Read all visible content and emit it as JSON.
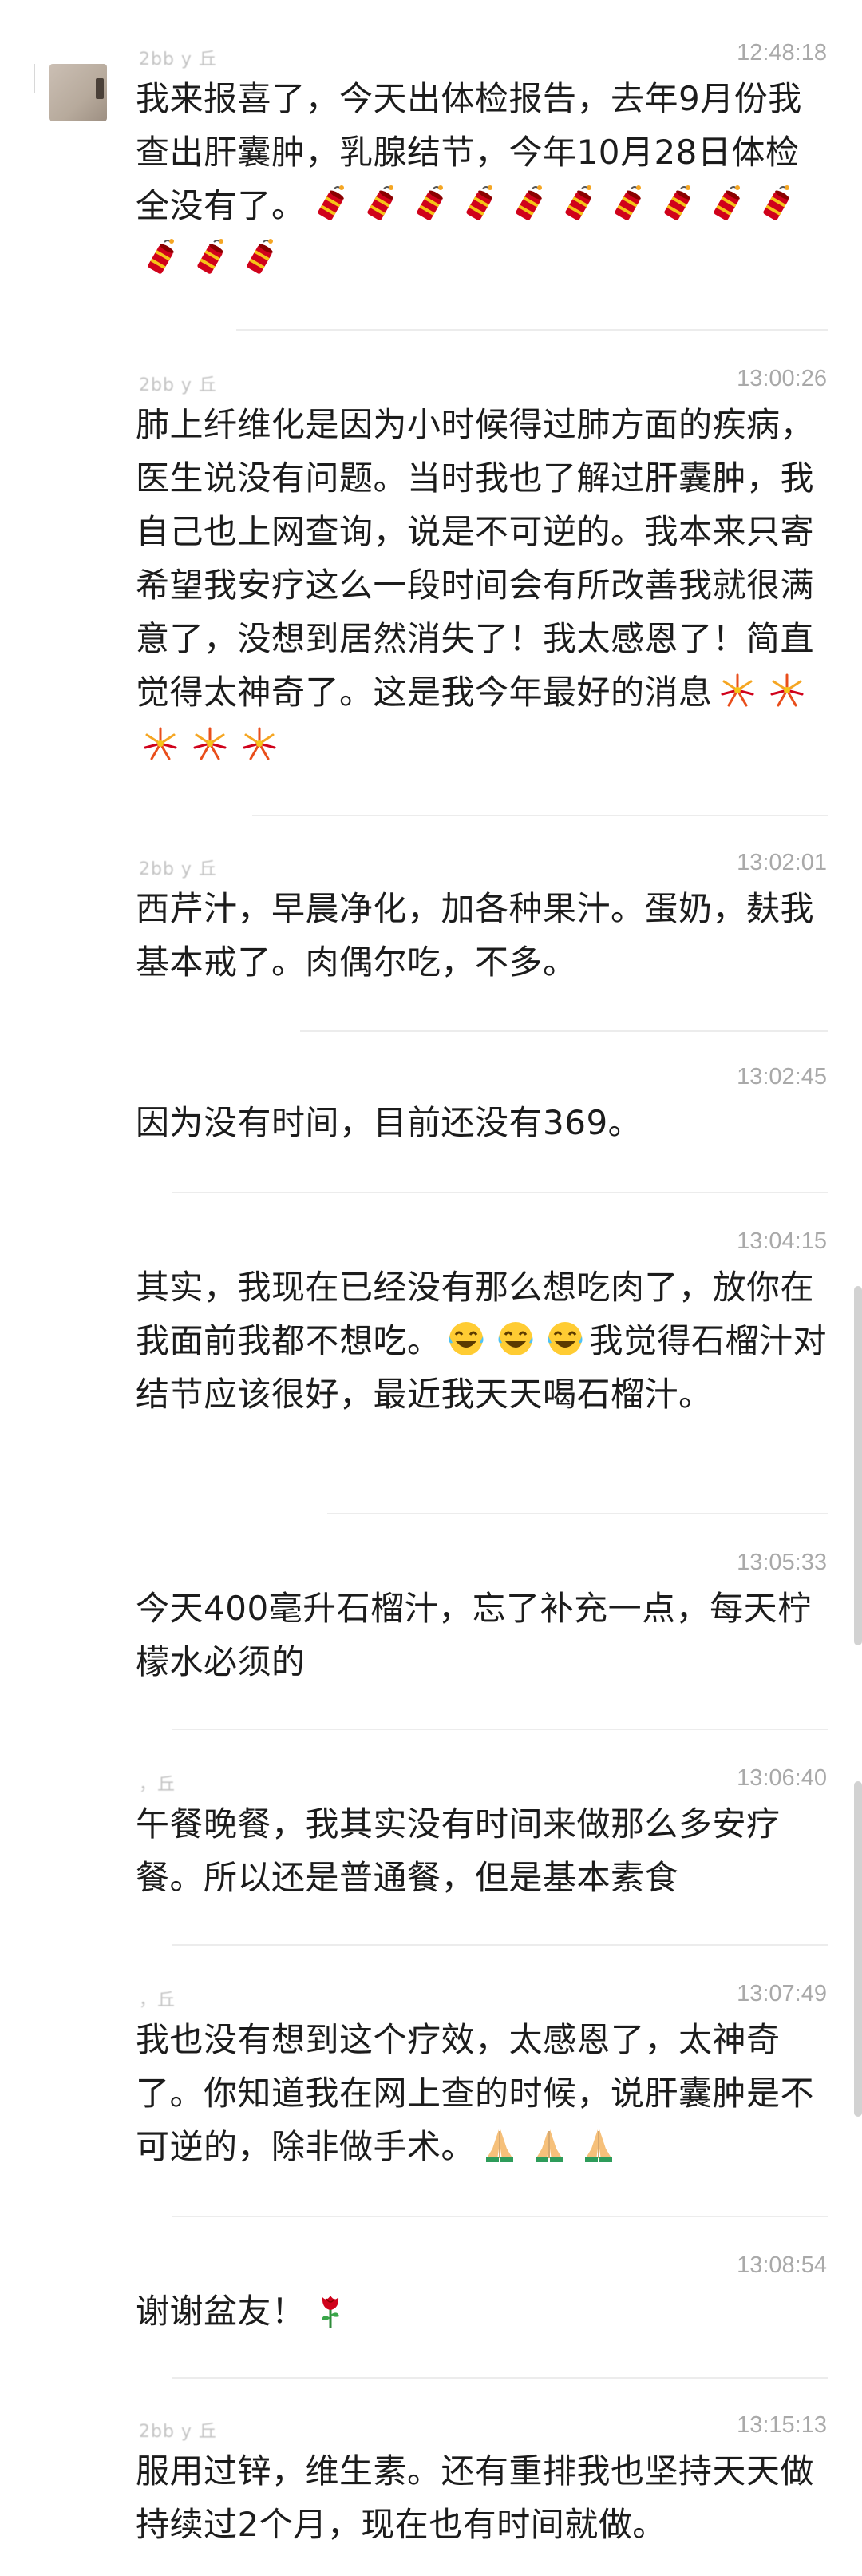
{
  "messages": [
    {
      "sender": "2bb y 丘",
      "time": "12:48:18",
      "segments": [
        {
          "t": "text",
          "v": "我来报喜了，今天出体检报告，去年9月份我查出肝囊肿，乳腺结节，今年10月28日体检全没有了。"
        },
        {
          "t": "icons",
          "icon": "firecracker-icon",
          "count": 13
        }
      ]
    },
    {
      "sender": "2bb y 丘",
      "time": "13:00:26",
      "segments": [
        {
          "t": "text",
          "v": "肺上纤维化是因为小时候得过肺方面的疾病，医生说没有问题。当时我也了解过肝囊肿，我自己也上网查询，说是不可逆的。我本来只寄希望我安疗这么一段时间会有所改善我就很满意了，没想到居然消失了！我太感恩了！简直觉得太神奇了。这是我今年最好的消息"
        },
        {
          "t": "icons",
          "icon": "fireworks-icon",
          "count": 5
        }
      ]
    },
    {
      "sender": "2bb y 丘",
      "time": "13:02:01",
      "segments": [
        {
          "t": "text",
          "v": "西芹汁，早晨净化，加各种果汁。蛋奶，麸我基本戒了。肉偶尔吃，不多。"
        }
      ]
    },
    {
      "sender": "",
      "time": "13:02:45",
      "segments": [
        {
          "t": "text",
          "v": "因为没有时间，目前还没有369。"
        }
      ]
    },
    {
      "sender": "",
      "time": "13:04:15",
      "segments": [
        {
          "t": "text",
          "v": "其实，我现在已经没有那么想吃肉了，放你在我面前我都不想吃。"
        },
        {
          "t": "icons",
          "icon": "tears-of-joy-icon",
          "count": 3
        },
        {
          "t": "text",
          "v": "我觉得石榴汁对结节应该很好，最近我天天喝石榴汁。"
        }
      ]
    },
    {
      "sender": "",
      "time": "13:05:33",
      "segments": [
        {
          "t": "text",
          "v": "今天400毫升石榴汁，忘了补充一点，每天柠檬水必须的"
        }
      ]
    },
    {
      "sender": "，丘",
      "time": "13:06:40",
      "segments": [
        {
          "t": "text",
          "v": "午餐晚餐，我其实没有时间来做那么多安疗餐。所以还是普通餐，但是基本素食"
        }
      ]
    },
    {
      "sender": "，丘",
      "time": "13:07:49",
      "segments": [
        {
          "t": "text",
          "v": "我也没有想到这个疗效，太感恩了，太神奇了。你知道我在网上查的时候，说肝囊肿是不可逆的，除非做手术。"
        },
        {
          "t": "icons",
          "icon": "folded-hands-icon",
          "count": 3
        }
      ]
    },
    {
      "sender": "",
      "time": "13:08:54",
      "segments": [
        {
          "t": "text",
          "v": "谢谢盆友！"
        },
        {
          "t": "icons",
          "icon": "rose-icon",
          "count": 1
        }
      ]
    },
    {
      "sender": "2bb y 丘",
      "time": "13:15:13",
      "segments": [
        {
          "t": "text",
          "v": "服用过锌，维生素。还有重排我也坚持天天做持续过2个月，现在也有时间就做。"
        }
      ]
    }
  ]
}
